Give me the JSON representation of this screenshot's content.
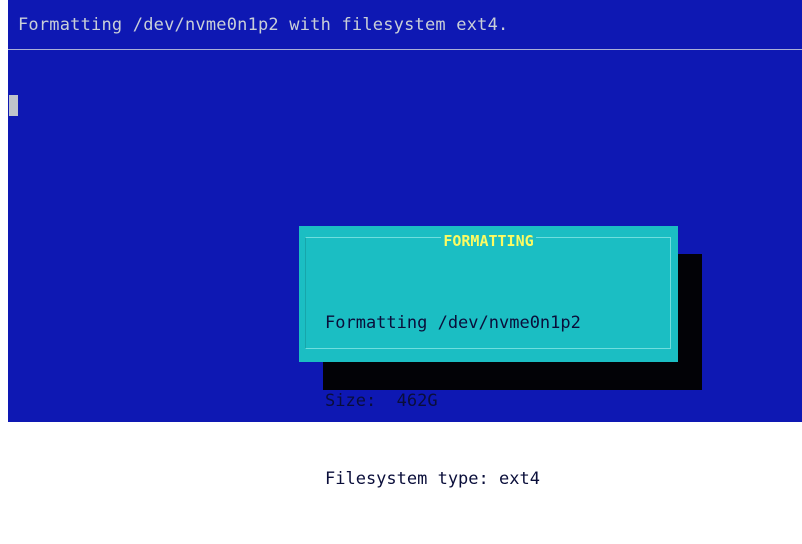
{
  "terminal": {
    "header_text": "Formatting /dev/nvme0n1p2 with filesystem ext4."
  },
  "dialog": {
    "title": "FORMATTING",
    "lines": [
      "Formatting /dev/nvme0n1p2",
      "Size:  462G",
      "Filesystem type: ext4"
    ]
  },
  "colors": {
    "background": "#0e18b3",
    "dialog_background": "#1bbec3",
    "title": "#fbfb62",
    "shadow": "#020206"
  }
}
